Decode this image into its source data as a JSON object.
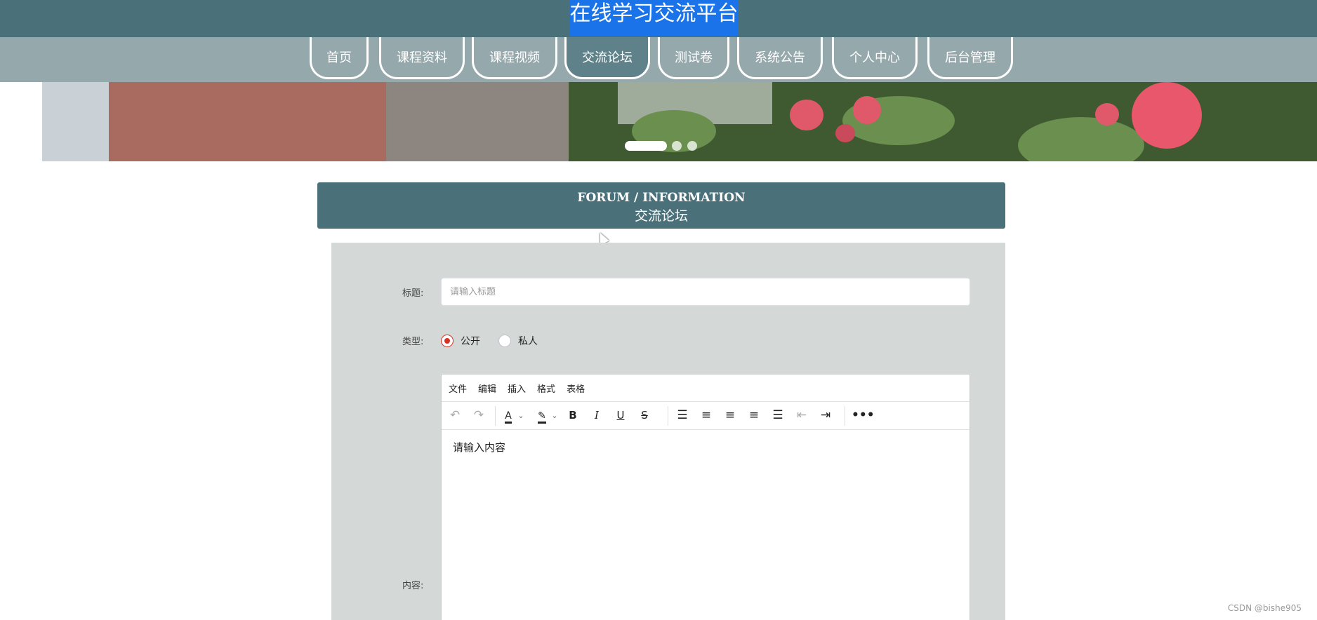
{
  "header": {
    "site_title": "在线学习交流平台"
  },
  "nav": {
    "items": [
      {
        "label": "首页"
      },
      {
        "label": "课程资料"
      },
      {
        "label": "课程视频"
      },
      {
        "label": "交流论坛"
      },
      {
        "label": "测试卷"
      },
      {
        "label": "系统公告"
      },
      {
        "label": "个人中心"
      },
      {
        "label": "后台管理"
      }
    ],
    "active": "交流论坛"
  },
  "carousel": {
    "slide_count": 3,
    "active_slide": 1
  },
  "section": {
    "title_en": "FORUM / INFORMATION",
    "title_cn": "交流论坛"
  },
  "form": {
    "title_label": "标题:",
    "title_placeholder": "请输入标题",
    "title_value": "",
    "type_label": "类型:",
    "type_options": [
      "公开",
      "私人"
    ],
    "type_selected": "公开",
    "content_label": "内容:"
  },
  "editor": {
    "menu": [
      "文件",
      "编辑",
      "插入",
      "格式",
      "表格"
    ],
    "toolbar_icons": [
      "undo-icon",
      "redo-icon",
      "text-color-icon",
      "highlight-color-icon",
      "bold-icon",
      "italic-icon",
      "underline-icon",
      "strikethrough-icon",
      "line-height-icon",
      "align-left-icon",
      "align-center-icon",
      "align-right-icon",
      "align-justify-icon",
      "outdent-icon",
      "indent-icon",
      "more-icon"
    ],
    "content_placeholder": "请输入内容"
  },
  "watermark": "CSDN @bishe905",
  "colors": {
    "header_bg": "#4a7079",
    "nav_bg": "#95a8ac",
    "panel_bg": "#d4d8d7",
    "radio_checked": "#d93025",
    "title_highlight": "#1a73e8"
  }
}
